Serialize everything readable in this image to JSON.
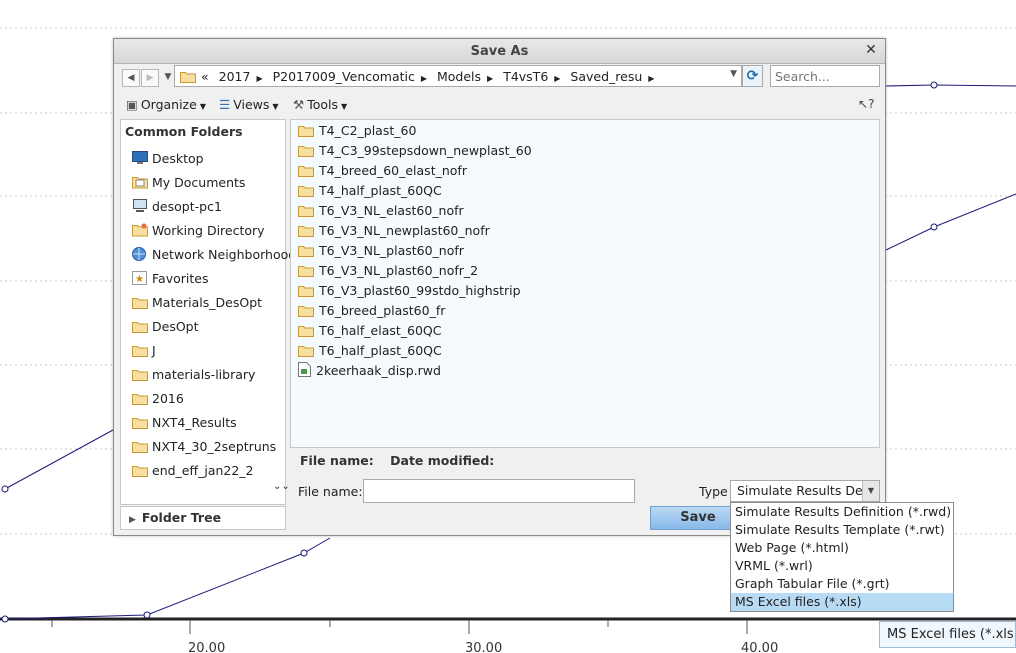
{
  "graph": {
    "x_ticks": [
      "20.00",
      "30.00",
      "40.00"
    ],
    "line_color": "#1b1b7a"
  },
  "dialog": {
    "title": "Save As",
    "close_glyph": "✕",
    "breadcrumb": [
      "2017",
      "P2017009_Vencomatic",
      "Models",
      "T4vsT6",
      "Saved_resu"
    ],
    "breadcrumb_prefix": "«",
    "search_placeholder": "Search...",
    "toolbar": {
      "organize": "Organize",
      "views": "Views",
      "tools": "Tools"
    },
    "help_glyph": "?",
    "common_folders": {
      "header": "Common Folders",
      "items": [
        {
          "label": "Desktop",
          "icon": "desktop-icon"
        },
        {
          "label": "My Documents",
          "icon": "documents-icon"
        },
        {
          "label": "desopt-pc1",
          "icon": "computer-icon"
        },
        {
          "label": "Working Directory",
          "icon": "working-directory-icon"
        },
        {
          "label": "Network Neighborhood",
          "icon": "network-icon"
        },
        {
          "label": "Favorites",
          "icon": "favorites-icon"
        },
        {
          "label": "Materials_DesOpt",
          "icon": "folder-icon"
        },
        {
          "label": "DesOpt",
          "icon": "folder-icon"
        },
        {
          "label": "J",
          "icon": "folder-icon"
        },
        {
          "label": "materials-library",
          "icon": "folder-icon"
        },
        {
          "label": "2016",
          "icon": "folder-icon"
        },
        {
          "label": "NXT4_Results",
          "icon": "folder-icon"
        },
        {
          "label": "NXT4_30_2septruns",
          "icon": "folder-icon"
        },
        {
          "label": "end_eff_jan22_2",
          "icon": "folder-icon"
        }
      ]
    },
    "folder_tree": "Folder Tree",
    "files": [
      {
        "name": "T4_C2_plast_60",
        "kind": "folder"
      },
      {
        "name": "T4_C3_99stepsdown_newplast_60",
        "kind": "folder"
      },
      {
        "name": "T4_breed_60_elast_nofr",
        "kind": "folder"
      },
      {
        "name": "T4_half_plast_60QC",
        "kind": "folder"
      },
      {
        "name": "T6_V3_NL_elast60_nofr",
        "kind": "folder"
      },
      {
        "name": "T6_V3_NL_newplast60_nofr",
        "kind": "folder"
      },
      {
        "name": "T6_V3_NL_plast60_nofr",
        "kind": "folder"
      },
      {
        "name": "T6_V3_NL_plast60_nofr_2",
        "kind": "folder"
      },
      {
        "name": "T6_V3_plast60_99stdo_highstrip",
        "kind": "folder"
      },
      {
        "name": "T6_breed_plast60_fr",
        "kind": "folder"
      },
      {
        "name": "T6_half_elast_60QC",
        "kind": "folder"
      },
      {
        "name": "T6_half_plast_60QC",
        "kind": "folder"
      },
      {
        "name": "2keerhaak_disp.rwd",
        "kind": "file"
      }
    ],
    "columns": {
      "file_name": "File name:",
      "date_modified": "Date modified:"
    },
    "file_name_label": "File name:",
    "file_name_value": "",
    "type_label": "Type",
    "type_selected": "Simulate Results Defi",
    "save_label": "Save"
  },
  "type_dropdown": {
    "options": [
      "Simulate Results Definition (*.rwd)",
      "Simulate Results Template (*.rwt)",
      "Web Page (*.html)",
      "VRML (*.wrl)",
      "Graph Tabular File (*.grt)",
      "MS Excel files (*.xls)"
    ],
    "selected_index": 5
  },
  "tooltip": "MS Excel files (*.xls"
}
